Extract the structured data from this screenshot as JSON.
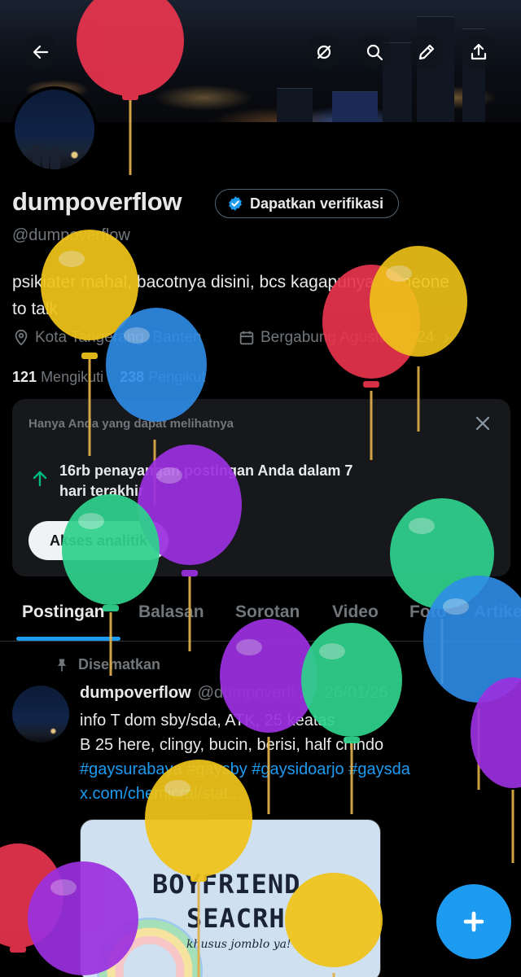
{
  "header": {
    "back_icon": "arrow-left-icon",
    "actions": [
      "hide-icon",
      "search-icon",
      "edit-icon",
      "share-icon"
    ]
  },
  "profile": {
    "name": "dumpoverflow",
    "verify_label": "Dapatkan verifikasi",
    "handle": "@dumpoverflow",
    "bio_line1": "psikiater mahal, bacotnya disini, bcs kagapunya someone",
    "bio_line2": "to talk",
    "location": "Kota Tangerang, Banten",
    "joined": "Bergabung Agustus 2024",
    "following_count": "121",
    "following_label": "Mengikuti",
    "followers_count": "238",
    "followers_label": "Pengikut"
  },
  "analytics_card": {
    "note": "Hanya Anda yang dapat melihatnya",
    "stat_line1": "16rb penayangan postingan Anda dalam 7",
    "stat_line2": "hari terakhir",
    "button": "Akses analitik"
  },
  "tabs": [
    "Postingan",
    "Balasan",
    "Sorotan",
    "Video",
    "Foto",
    "Artikel"
  ],
  "pinned_post": {
    "pinned_label": "Disematkan",
    "author": "dumpoverflow",
    "handle_short": "@dumpoverfl...",
    "date": "· 26/01/26",
    "x_mark": "X",
    "line1": "info T dom sby/sda, ATK, 25 keatas",
    "line2": "B 25 here, clingy, bucin, berisi, half chindo",
    "hashtags": "#gaysurabaya #gaysby #gaysidoarjo #gaysda",
    "link": "x.com/chemicral/stat...",
    "media_title1": "BOYFRIEND",
    "media_title2": "SEACRH",
    "media_sub": "khusus jomblo ya!"
  },
  "colors": {
    "accent": "#1d9bf0",
    "positive": "#00ba7c",
    "muted": "#71767b"
  }
}
